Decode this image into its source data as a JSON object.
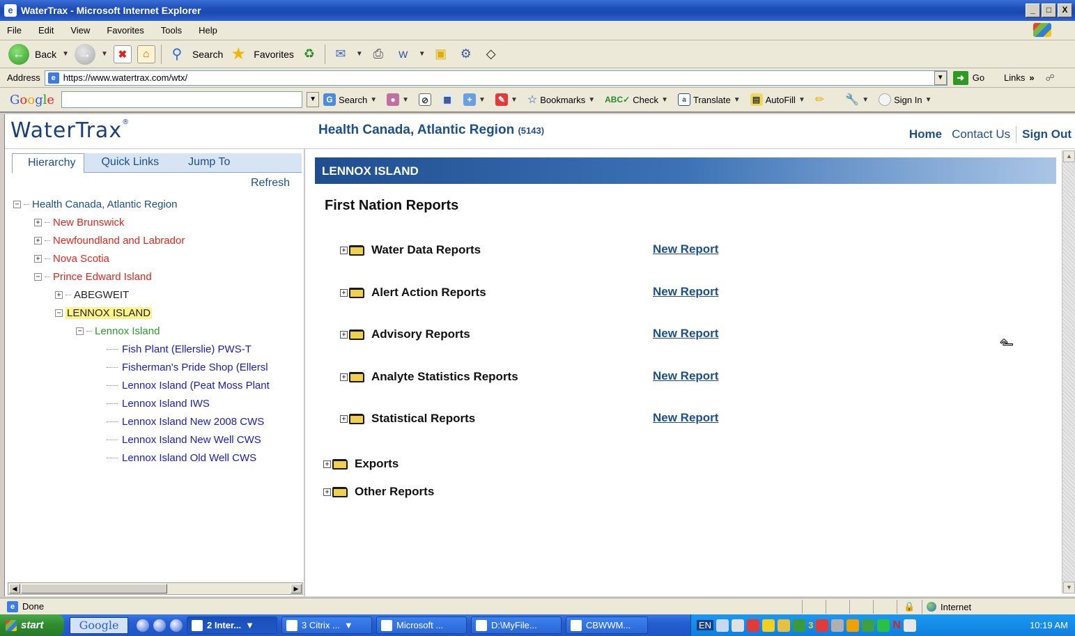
{
  "window": {
    "title": "WaterTrax - Microsoft Internet Explorer",
    "buttons": [
      "_",
      "□",
      "X"
    ]
  },
  "menu": [
    "File",
    "Edit",
    "View",
    "Favorites",
    "Tools",
    "Help"
  ],
  "toolbar": {
    "back": "Back",
    "search": "Search",
    "favorites": "Favorites"
  },
  "address": {
    "label": "Address",
    "url": "https://www.watertrax.com/wtx/",
    "go": "Go",
    "links": "Links"
  },
  "google_toolbar": {
    "logo": [
      "G",
      "o",
      "o",
      "g",
      "l",
      "e"
    ],
    "search": "Search",
    "bookmarks": "Bookmarks",
    "check": "Check",
    "translate": "Translate",
    "autofill": "AutoFill",
    "signin": "Sign In"
  },
  "site": {
    "logo": "WaterTrax",
    "org_name": "Health Canada, Atlantic Region",
    "org_code": "(5143)",
    "nav": {
      "home": "Home",
      "contact": "Contact Us",
      "signout": "Sign Out"
    }
  },
  "left_panel": {
    "tabs": [
      "Hierarchy",
      "Quick Links",
      "Jump To"
    ],
    "refresh": "Refresh",
    "tree": {
      "root": "Health Canada, Atlantic Region",
      "provinces": [
        "New Brunswick",
        "Newfoundland and Labrador",
        "Nova Scotia",
        "Prince Edward Island"
      ],
      "pei_children": [
        "ABEGWEIT",
        "LENNOX ISLAND"
      ],
      "community": "Lennox Island",
      "systems": [
        "Fish Plant (Ellerslie) PWS-T",
        "Fisherman's Pride Shop (Ellersl",
        "Lennox Island (Peat Moss Plant",
        "Lennox Island IWS",
        "Lennox Island New 2008 CWS",
        "Lennox Island New Well CWS",
        "Lennox Island Old Well CWS"
      ]
    }
  },
  "content": {
    "banner": "LENNOX ISLAND",
    "section_title": "First Nation Reports",
    "reports": [
      {
        "name": "Water Data Reports",
        "action": "New Report"
      },
      {
        "name": "Alert Action Reports",
        "action": "New Report"
      },
      {
        "name": "Advisory Reports",
        "action": "New Report"
      },
      {
        "name": "Analyte Statistics Reports",
        "action": "New Report"
      },
      {
        "name": "Statistical Reports",
        "action": "New Report"
      }
    ],
    "other_sections": [
      "Exports",
      "Other Reports"
    ]
  },
  "status": {
    "text": "Done",
    "zone": "Internet"
  },
  "taskbar": {
    "start": "start",
    "google": "Google",
    "tasks": [
      "2 Inter...",
      "3 Citrix ...",
      "Microsoft ...",
      "D:\\MyFile...",
      "CBWWM..."
    ],
    "lang": "EN",
    "tray_count": "3",
    "clock": "10:19 AM"
  }
}
